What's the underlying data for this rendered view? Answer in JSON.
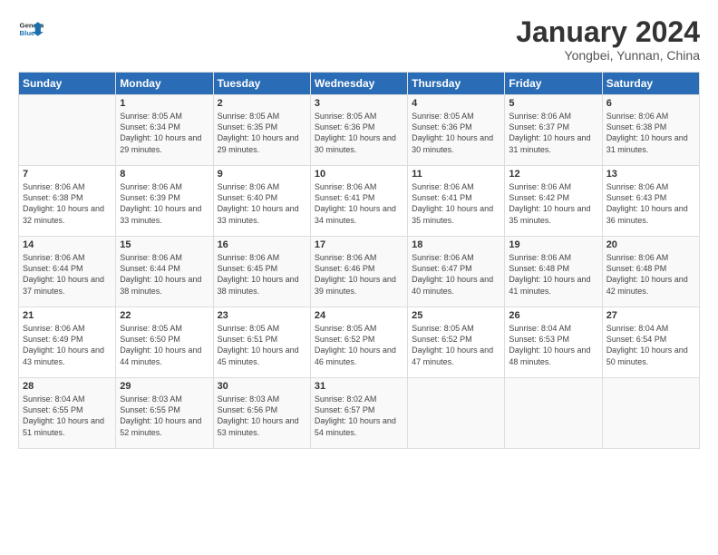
{
  "header": {
    "logo_line1": "General",
    "logo_line2": "Blue",
    "month": "January 2024",
    "location": "Yongbei, Yunnan, China"
  },
  "days_of_week": [
    "Sunday",
    "Monday",
    "Tuesday",
    "Wednesday",
    "Thursday",
    "Friday",
    "Saturday"
  ],
  "weeks": [
    [
      {
        "num": "",
        "sunrise": "",
        "sunset": "",
        "daylight": ""
      },
      {
        "num": "1",
        "sunrise": "8:05 AM",
        "sunset": "6:34 PM",
        "daylight": "10 hours and 29 minutes."
      },
      {
        "num": "2",
        "sunrise": "8:05 AM",
        "sunset": "6:35 PM",
        "daylight": "10 hours and 29 minutes."
      },
      {
        "num": "3",
        "sunrise": "8:05 AM",
        "sunset": "6:36 PM",
        "daylight": "10 hours and 30 minutes."
      },
      {
        "num": "4",
        "sunrise": "8:05 AM",
        "sunset": "6:36 PM",
        "daylight": "10 hours and 30 minutes."
      },
      {
        "num": "5",
        "sunrise": "8:06 AM",
        "sunset": "6:37 PM",
        "daylight": "10 hours and 31 minutes."
      },
      {
        "num": "6",
        "sunrise": "8:06 AM",
        "sunset": "6:38 PM",
        "daylight": "10 hours and 31 minutes."
      }
    ],
    [
      {
        "num": "7",
        "sunrise": "8:06 AM",
        "sunset": "6:38 PM",
        "daylight": "10 hours and 32 minutes."
      },
      {
        "num": "8",
        "sunrise": "8:06 AM",
        "sunset": "6:39 PM",
        "daylight": "10 hours and 33 minutes."
      },
      {
        "num": "9",
        "sunrise": "8:06 AM",
        "sunset": "6:40 PM",
        "daylight": "10 hours and 33 minutes."
      },
      {
        "num": "10",
        "sunrise": "8:06 AM",
        "sunset": "6:41 PM",
        "daylight": "10 hours and 34 minutes."
      },
      {
        "num": "11",
        "sunrise": "8:06 AM",
        "sunset": "6:41 PM",
        "daylight": "10 hours and 35 minutes."
      },
      {
        "num": "12",
        "sunrise": "8:06 AM",
        "sunset": "6:42 PM",
        "daylight": "10 hours and 35 minutes."
      },
      {
        "num": "13",
        "sunrise": "8:06 AM",
        "sunset": "6:43 PM",
        "daylight": "10 hours and 36 minutes."
      }
    ],
    [
      {
        "num": "14",
        "sunrise": "8:06 AM",
        "sunset": "6:44 PM",
        "daylight": "10 hours and 37 minutes."
      },
      {
        "num": "15",
        "sunrise": "8:06 AM",
        "sunset": "6:44 PM",
        "daylight": "10 hours and 38 minutes."
      },
      {
        "num": "16",
        "sunrise": "8:06 AM",
        "sunset": "6:45 PM",
        "daylight": "10 hours and 38 minutes."
      },
      {
        "num": "17",
        "sunrise": "8:06 AM",
        "sunset": "6:46 PM",
        "daylight": "10 hours and 39 minutes."
      },
      {
        "num": "18",
        "sunrise": "8:06 AM",
        "sunset": "6:47 PM",
        "daylight": "10 hours and 40 minutes."
      },
      {
        "num": "19",
        "sunrise": "8:06 AM",
        "sunset": "6:48 PM",
        "daylight": "10 hours and 41 minutes."
      },
      {
        "num": "20",
        "sunrise": "8:06 AM",
        "sunset": "6:48 PM",
        "daylight": "10 hours and 42 minutes."
      }
    ],
    [
      {
        "num": "21",
        "sunrise": "8:06 AM",
        "sunset": "6:49 PM",
        "daylight": "10 hours and 43 minutes."
      },
      {
        "num": "22",
        "sunrise": "8:05 AM",
        "sunset": "6:50 PM",
        "daylight": "10 hours and 44 minutes."
      },
      {
        "num": "23",
        "sunrise": "8:05 AM",
        "sunset": "6:51 PM",
        "daylight": "10 hours and 45 minutes."
      },
      {
        "num": "24",
        "sunrise": "8:05 AM",
        "sunset": "6:52 PM",
        "daylight": "10 hours and 46 minutes."
      },
      {
        "num": "25",
        "sunrise": "8:05 AM",
        "sunset": "6:52 PM",
        "daylight": "10 hours and 47 minutes."
      },
      {
        "num": "26",
        "sunrise": "8:04 AM",
        "sunset": "6:53 PM",
        "daylight": "10 hours and 48 minutes."
      },
      {
        "num": "27",
        "sunrise": "8:04 AM",
        "sunset": "6:54 PM",
        "daylight": "10 hours and 50 minutes."
      }
    ],
    [
      {
        "num": "28",
        "sunrise": "8:04 AM",
        "sunset": "6:55 PM",
        "daylight": "10 hours and 51 minutes."
      },
      {
        "num": "29",
        "sunrise": "8:03 AM",
        "sunset": "6:55 PM",
        "daylight": "10 hours and 52 minutes."
      },
      {
        "num": "30",
        "sunrise": "8:03 AM",
        "sunset": "6:56 PM",
        "daylight": "10 hours and 53 minutes."
      },
      {
        "num": "31",
        "sunrise": "8:02 AM",
        "sunset": "6:57 PM",
        "daylight": "10 hours and 54 minutes."
      },
      {
        "num": "",
        "sunrise": "",
        "sunset": "",
        "daylight": ""
      },
      {
        "num": "",
        "sunrise": "",
        "sunset": "",
        "daylight": ""
      },
      {
        "num": "",
        "sunrise": "",
        "sunset": "",
        "daylight": ""
      }
    ]
  ],
  "labels": {
    "sunrise_prefix": "Sunrise: ",
    "sunset_prefix": "Sunset: ",
    "daylight_prefix": "Daylight: "
  }
}
